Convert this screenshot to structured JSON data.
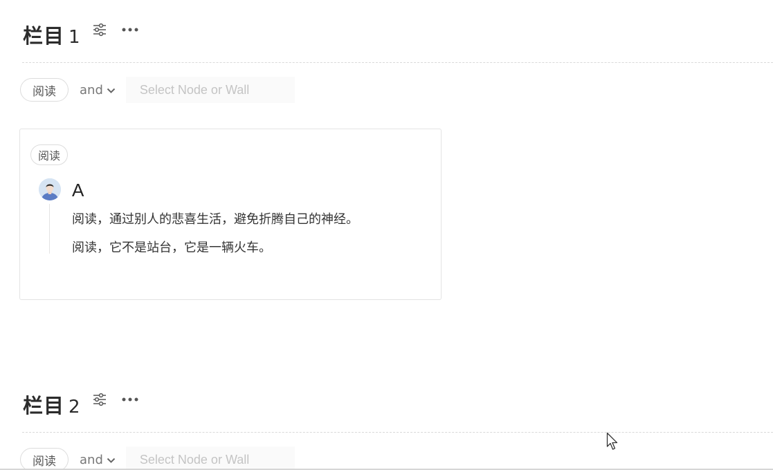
{
  "sections": [
    {
      "title": "栏目",
      "number": "1",
      "filter": {
        "tag": "阅读",
        "operator": "and",
        "placeholder": "Select Node or Wall"
      },
      "cards": [
        {
          "tag": "阅读",
          "author": "A",
          "quotes": [
            "阅读，通过别人的悲喜生活，避免折腾自己的神经。",
            "阅读，它不是站台，它是一辆火车。"
          ]
        }
      ]
    },
    {
      "title": "栏目",
      "number": "2",
      "filter": {
        "tag": "阅读",
        "operator": "and",
        "placeholder": "Select Node or Wall"
      }
    }
  ],
  "icons": {
    "settings": "sliders-icon",
    "more": "more-horizontal-icon",
    "dropdown": "chevron-down-icon"
  }
}
